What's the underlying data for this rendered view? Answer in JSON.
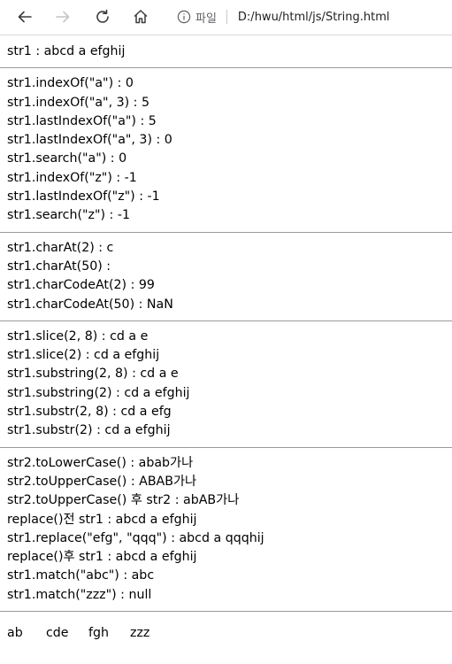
{
  "browser": {
    "scheme_label": "파일",
    "url": "D:/hwu/html/js/String.html"
  },
  "sections": [
    [
      "str1 : abcd a efghij"
    ],
    [
      "str1.indexOf(\"a\") : 0",
      "str1.indexOf(\"a\", 3) : 5",
      "str1.lastIndexOf(\"a\") : 5",
      "str1.lastIndexOf(\"a\", 3) : 0",
      "str1.search(\"a\") : 0",
      "str1.indexOf(\"z\") : -1",
      "str1.lastIndexOf(\"z\") : -1",
      "str1.search(\"z\") : -1"
    ],
    [
      "str1.charAt(2) : c",
      "str1.charAt(50) :",
      "str1.charCodeAt(2) : 99",
      "str1.charCodeAt(50) : NaN"
    ],
    [
      "str1.slice(2, 8) : cd a e",
      "str1.slice(2) : cd a efghij",
      "str1.substring(2, 8) : cd a e",
      "str1.substring(2) : cd a efghij",
      "str1.substr(2, 8) : cd a efg",
      "str1.substr(2) : cd a efghij"
    ],
    [
      "str2.toLowerCase() : abab가나",
      "str2.toUpperCase() : ABAB가나",
      "str2.toUpperCase() 후 str2 : abAB가나",
      "replace()전 str1 : abcd a efghij",
      "str1.replace(\"efg\", \"qqq\") : abcd a qqqhij",
      "replace()후 str1 : abcd a efghij",
      "str1.match(\"abc\") : abc",
      "str1.match(\"zzz\") : null"
    ]
  ],
  "words": [
    "ab",
    "cde",
    "fgh",
    "zzz"
  ]
}
